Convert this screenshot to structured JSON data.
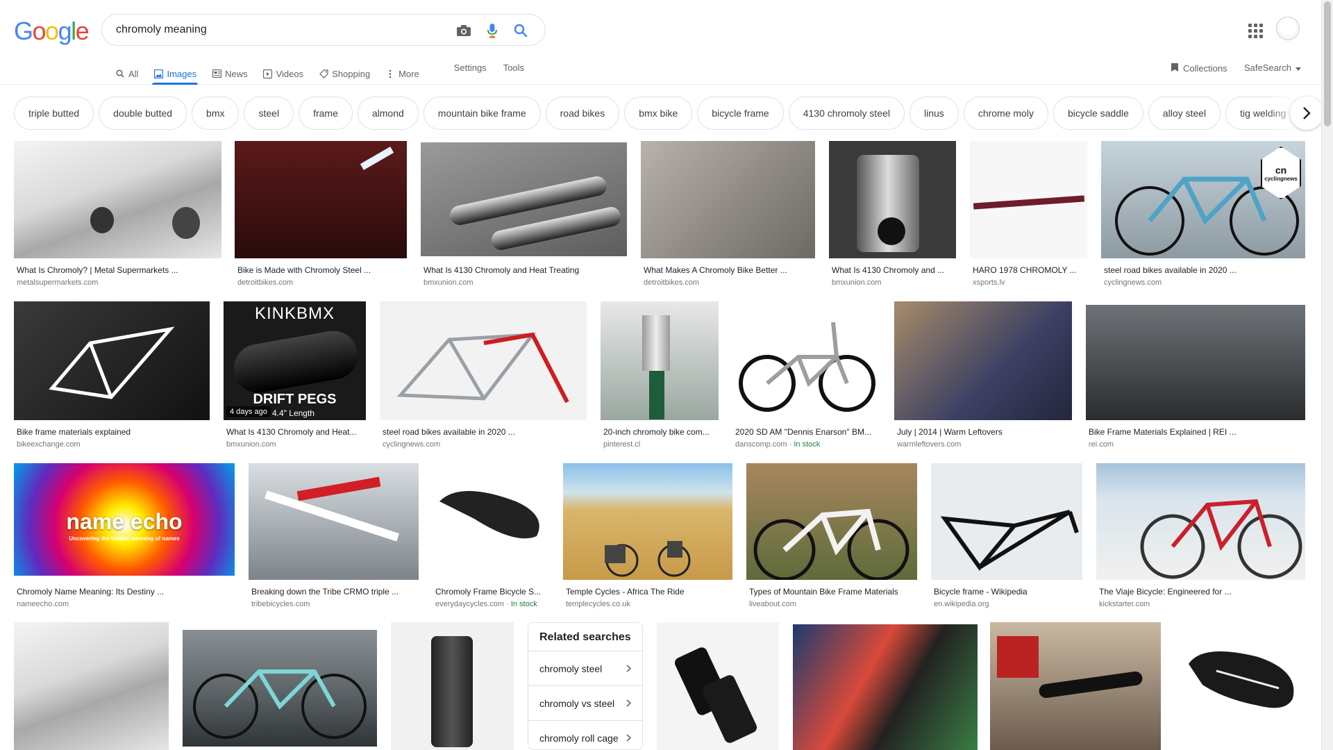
{
  "logo": {
    "letters": [
      "G",
      "o",
      "o",
      "g",
      "l",
      "e"
    ],
    "colors": [
      "#4285f4",
      "#ea4335",
      "#fbbc05",
      "#4285f4",
      "#34a853",
      "#ea4335"
    ]
  },
  "search": {
    "query": "chromoly meaning"
  },
  "tabs": [
    {
      "label": "All",
      "icon": "search-icon"
    },
    {
      "label": "Images",
      "icon": "image-icon",
      "active": true
    },
    {
      "label": "News",
      "icon": "news-icon"
    },
    {
      "label": "Videos",
      "icon": "video-icon"
    },
    {
      "label": "Shopping",
      "icon": "tag-icon"
    },
    {
      "label": "More",
      "icon": "more-vert-icon"
    }
  ],
  "tools": {
    "settings": "Settings",
    "tools": "Tools"
  },
  "header_right": {
    "collections": "Collections",
    "safesearch": "SafeSearch"
  },
  "chips": [
    "triple butted",
    "double butted",
    "bmx",
    "steel",
    "frame",
    "almond",
    "mountain bike frame",
    "road bikes",
    "bmx bike",
    "bicycle frame",
    "4130 chromoly steel",
    "linus",
    "chrome moly",
    "bicycle saddle",
    "alloy steel",
    "tig welding"
  ],
  "results": [
    {
      "title": "What Is Chromoly? | Metal Supermarkets ...",
      "source": "metalsupermarkets.com"
    },
    {
      "title": "Bike is Made with Chromoly Steel ...",
      "source": "detroitbikes.com"
    },
    {
      "title": "What Is 4130 Chromoly and Heat Treating",
      "source": "bmxunion.com"
    },
    {
      "title": "What Makes A Chromoly Bike Better ...",
      "source": "detroitbikes.com"
    },
    {
      "title": "What Is 4130 Chromoly and ...",
      "source": "bmxunion.com"
    },
    {
      "title": "HARO 1978 CHROMOLY ...",
      "source": "xsports.lv"
    },
    {
      "title": "steel road bikes available in 2020 ...",
      "source": "cyclingnews.com",
      "overlay": "cn",
      "overlay2": "cyclingnews"
    },
    {
      "title": "Bike frame materials explained",
      "source": "bikeexchange.com"
    },
    {
      "title": "What Is 4130 Chromoly and Heat...",
      "source": "bmxunion.com",
      "badge": "4 days ago",
      "overlay": "KINKBMX",
      "overlay2": "DRIFT PEGS",
      "overlay3": "4.4\" Length"
    },
    {
      "title": "steel road bikes available in 2020 ...",
      "source": "cyclingnews.com"
    },
    {
      "title": "20-inch chromoly bike com...",
      "source": "pinterest.cl"
    },
    {
      "title": "2020 SD AM \"Dennis Enarson\" BM...",
      "source": "danscomp.com",
      "stock": "In stock"
    },
    {
      "title": "July | 2014 | Warm Leftovers",
      "source": "warmleftovers.com"
    },
    {
      "title": "Bike Frame Materials Explained | REI ...",
      "source": "rei.com"
    },
    {
      "title": "Chromoly Name Meaning: Its Destiny ...",
      "source": "nameecho.com",
      "overlay": "name echo",
      "overlay2": "Uncovering the hidden meaning of names"
    },
    {
      "title": "Breaking down the Tribe CRMO triple ...",
      "source": "tribebicycles.com"
    },
    {
      "title": "Chromoly Frame Bicycle S...",
      "source": "everydaycycles.com",
      "stock": "In stock"
    },
    {
      "title": "Temple Cycles - Africa The Ride",
      "source": "templecycles.co.uk"
    },
    {
      "title": "Types of Mountain Bike Frame Materials",
      "source": "liveabout.com"
    },
    {
      "title": "Bicycle frame - Wikipedia",
      "source": "en.wikipedia.org"
    },
    {
      "title": "The Viaje Bicycle: Engineered for ...",
      "source": "kickstarter.com"
    }
  ],
  "related": {
    "title": "Related searches",
    "items": [
      "chromoly steel",
      "chromoly vs steel",
      "chromoly roll cage"
    ]
  }
}
